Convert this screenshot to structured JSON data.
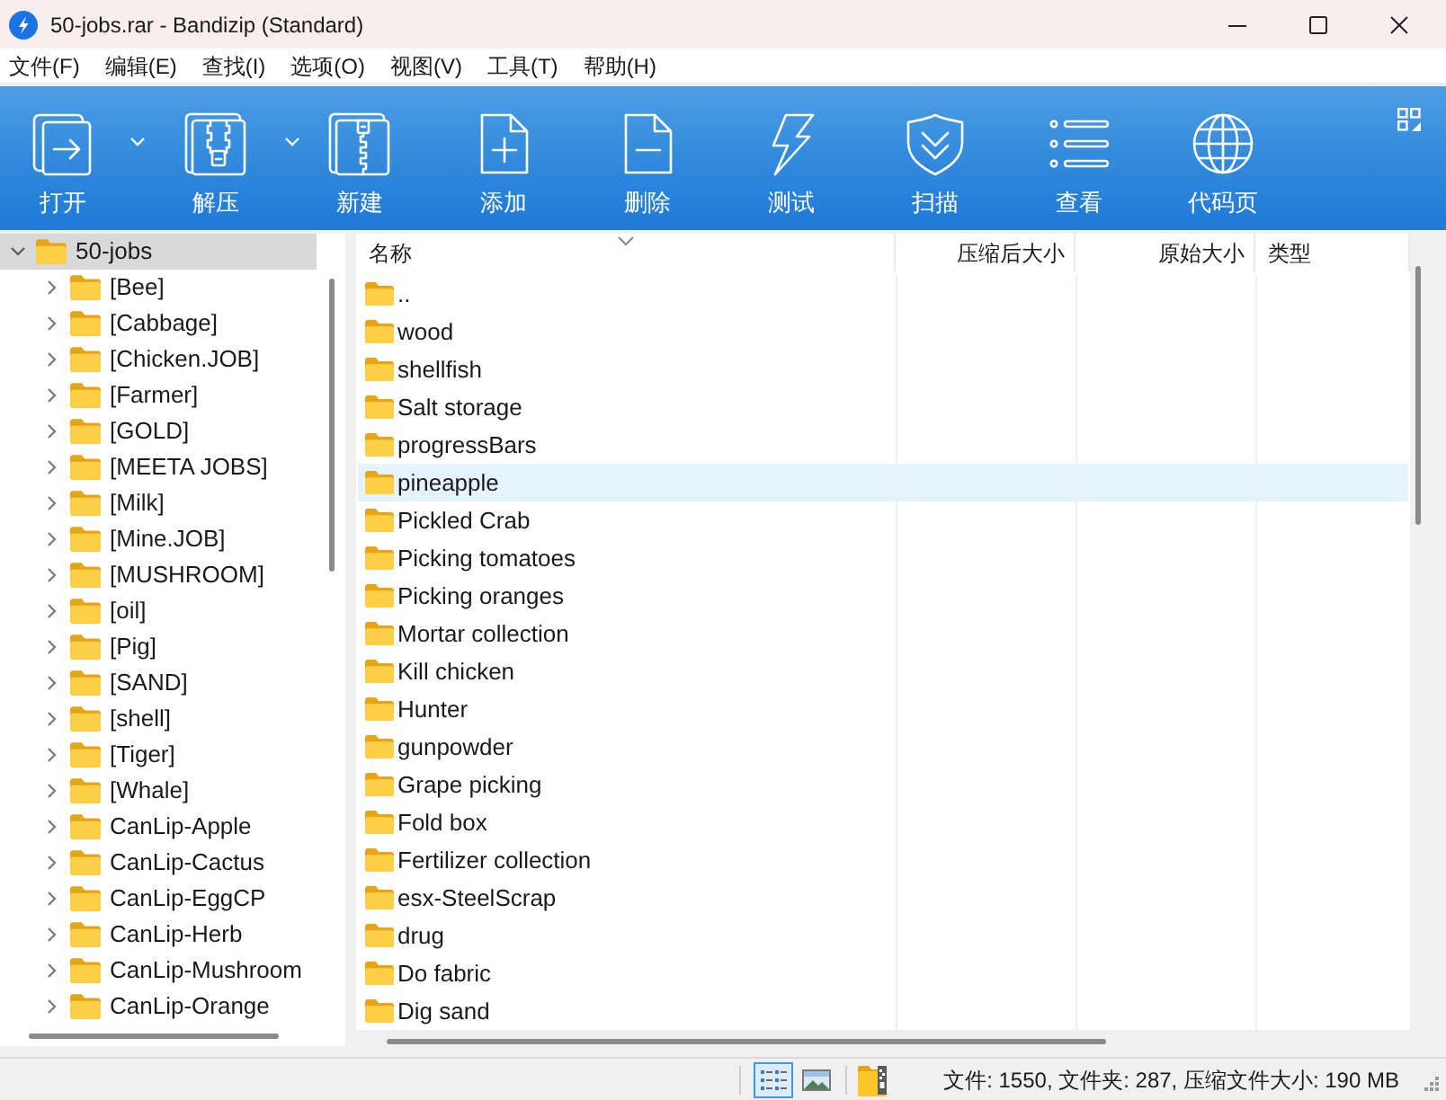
{
  "window": {
    "title": "50-jobs.rar - Bandizip (Standard)"
  },
  "menu": [
    "文件(F)",
    "编辑(E)",
    "查找(I)",
    "选项(O)",
    "视图(V)",
    "工具(T)",
    "帮助(H)"
  ],
  "toolbar": [
    {
      "kind": "open",
      "label": "打开",
      "dropdown": true
    },
    {
      "kind": "extract",
      "label": "解压",
      "dropdown": true
    },
    {
      "kind": "new",
      "label": "新建",
      "dropdown": false
    },
    {
      "kind": "add",
      "label": "添加",
      "dropdown": false
    },
    {
      "kind": "delete",
      "label": "删除",
      "dropdown": false
    },
    {
      "kind": "test",
      "label": "测试",
      "dropdown": false
    },
    {
      "kind": "scan",
      "label": "扫描",
      "dropdown": false
    },
    {
      "kind": "view",
      "label": "查看",
      "dropdown": false
    },
    {
      "kind": "codepage",
      "label": "代码页",
      "dropdown": false
    }
  ],
  "tree": {
    "items": [
      {
        "label": "50-jobs",
        "expanded": true,
        "selected": true,
        "children": [
          {
            "label": "[Bee]",
            "expanded": false,
            "selected": false
          },
          {
            "label": "[Cabbage]",
            "expanded": false,
            "selected": false
          },
          {
            "label": "[Chicken.JOB]",
            "expanded": false,
            "selected": false
          },
          {
            "label": "[Farmer]",
            "expanded": false,
            "selected": false
          },
          {
            "label": "[GOLD]",
            "expanded": false,
            "selected": false
          },
          {
            "label": "[MEETA JOBS]",
            "expanded": false,
            "selected": false
          },
          {
            "label": "[Milk]",
            "expanded": false,
            "selected": false
          },
          {
            "label": "[Mine.JOB]",
            "expanded": false,
            "selected": false
          },
          {
            "label": "[MUSHROOM]",
            "expanded": false,
            "selected": false
          },
          {
            "label": "[oil]",
            "expanded": false,
            "selected": false
          },
          {
            "label": "[Pig]",
            "expanded": false,
            "selected": false
          },
          {
            "label": "[SAND]",
            "expanded": false,
            "selected": false
          },
          {
            "label": "[shell]",
            "expanded": false,
            "selected": false
          },
          {
            "label": "[Tiger]",
            "expanded": false,
            "selected": false
          },
          {
            "label": "[Whale]",
            "expanded": false,
            "selected": false
          },
          {
            "label": "CanLip-Apple",
            "expanded": false,
            "selected": false
          },
          {
            "label": "CanLip-Cactus",
            "expanded": false,
            "selected": false
          },
          {
            "label": "CanLip-EggCP",
            "expanded": false,
            "selected": false
          },
          {
            "label": "CanLip-Herb",
            "expanded": false,
            "selected": false
          },
          {
            "label": "CanLip-Mushroom",
            "expanded": false,
            "selected": false
          },
          {
            "label": "CanLip-Orange",
            "expanded": false,
            "selected": false
          }
        ]
      }
    ]
  },
  "list": {
    "columns": [
      {
        "label": "名称",
        "sorted": true
      },
      {
        "label": "压缩后大小",
        "sorted": false
      },
      {
        "label": "原始大小",
        "sorted": false
      },
      {
        "label": "类型",
        "sorted": false
      }
    ],
    "rows": [
      {
        "name": "..",
        "selected": false
      },
      {
        "name": "wood",
        "selected": false
      },
      {
        "name": "shellfish",
        "selected": false
      },
      {
        "name": "Salt storage",
        "selected": false
      },
      {
        "name": "progressBars",
        "selected": false
      },
      {
        "name": "pineapple",
        "selected": true
      },
      {
        "name": "Pickled Crab",
        "selected": false
      },
      {
        "name": "Picking tomatoes",
        "selected": false
      },
      {
        "name": "Picking oranges",
        "selected": false
      },
      {
        "name": "Mortar collection",
        "selected": false
      },
      {
        "name": "Kill chicken",
        "selected": false
      },
      {
        "name": "Hunter",
        "selected": false
      },
      {
        "name": "gunpowder",
        "selected": false
      },
      {
        "name": "Grape picking",
        "selected": false
      },
      {
        "name": "Fold box",
        "selected": false
      },
      {
        "name": "Fertilizer collection",
        "selected": false
      },
      {
        "name": "esx-SteelScrap",
        "selected": false
      },
      {
        "name": "drug",
        "selected": false
      },
      {
        "name": "Do fabric",
        "selected": false
      },
      {
        "name": "Dig sand",
        "selected": false
      }
    ]
  },
  "status_bar": {
    "view_modes": [
      {
        "kind": "details",
        "selected": true
      },
      {
        "kind": "thumbnails",
        "selected": false
      }
    ],
    "summary": "文件: 1550, 文件夹: 287, 压缩文件大小: 190 MB"
  }
}
